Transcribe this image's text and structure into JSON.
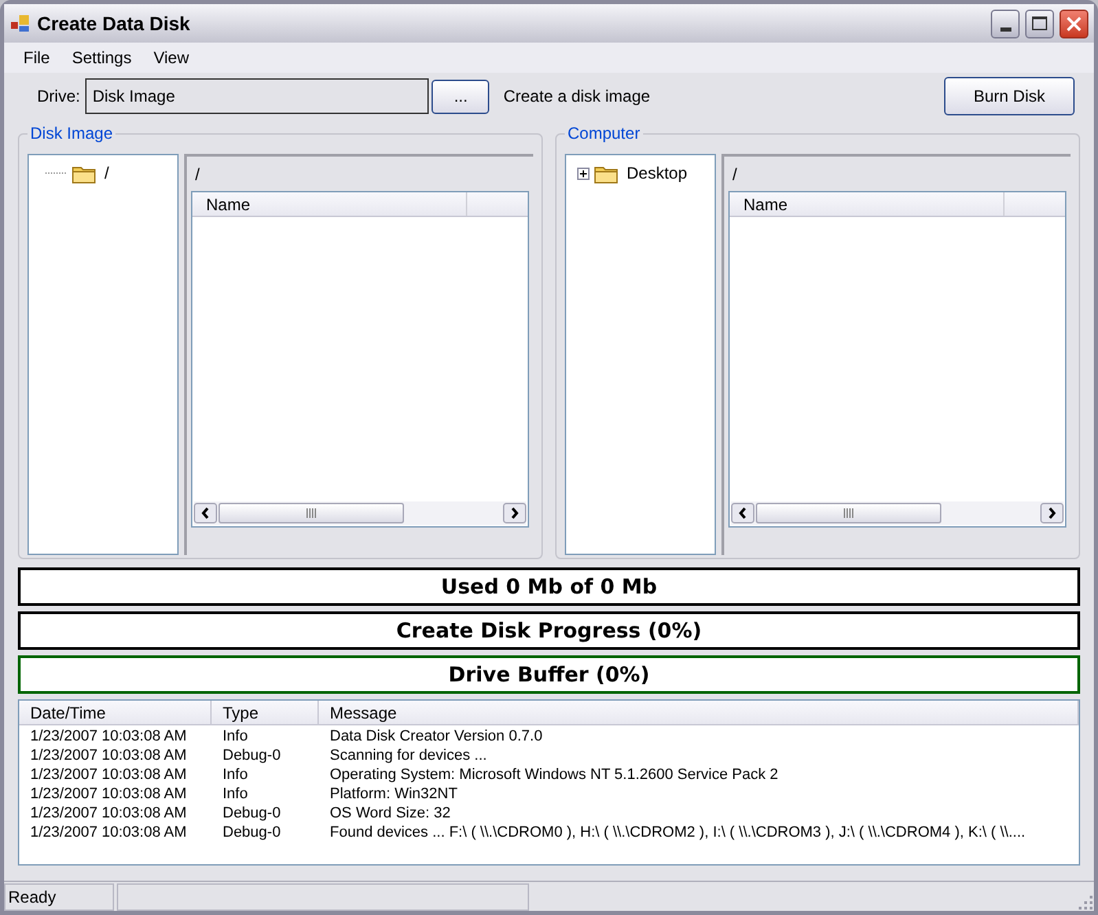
{
  "window": {
    "title": "Create Data Disk"
  },
  "menu": [
    "File",
    "Settings",
    "View"
  ],
  "drive": {
    "label": "Drive:",
    "value": "Disk Image",
    "browse_button": "...",
    "hint": "Create a disk image",
    "burn_button": "Burn Disk"
  },
  "panels": [
    {
      "title": "Disk Image",
      "tree": [
        {
          "label": "/",
          "has_children": false
        }
      ],
      "path": "/",
      "columns": [
        "Name"
      ]
    },
    {
      "title": "Computer",
      "tree": [
        {
          "label": "Desktop",
          "has_children": true
        }
      ],
      "path": "/",
      "columns": [
        "Name"
      ]
    }
  ],
  "bars": [
    {
      "label": "Used 0 Mb of 0 Mb",
      "color": "#000000"
    },
    {
      "label": "Create Disk Progress (0%)",
      "color": "#000000"
    },
    {
      "label": "Drive Buffer (0%)",
      "color": "#006400"
    }
  ],
  "log": {
    "columns": [
      "Date/Time",
      "Type",
      "Message"
    ],
    "rows": [
      {
        "date_time": "1/23/2007 10:03:08 AM",
        "type": "Info",
        "message": "Data Disk Creator Version 0.7.0"
      },
      {
        "date_time": "1/23/2007 10:03:08 AM",
        "type": "Debug-0",
        "message": "Scanning for devices ..."
      },
      {
        "date_time": "1/23/2007 10:03:08 AM",
        "type": "Info",
        "message": "Operating System: Microsoft Windows NT 5.1.2600 Service Pack 2"
      },
      {
        "date_time": "1/23/2007 10:03:08 AM",
        "type": "Info",
        "message": "Platform: Win32NT"
      },
      {
        "date_time": "1/23/2007 10:03:08 AM",
        "type": "Debug-0",
        "message": "OS Word Size: 32"
      },
      {
        "date_time": "1/23/2007 10:03:08 AM",
        "type": "Debug-0",
        "message": "Found devices ... F:\\ ( \\\\.\\CDROM0 ), H:\\ ( \\\\.\\CDROM2 ), I:\\ ( \\\\.\\CDROM3 ), J:\\ ( \\\\.\\CDROM4 ), K:\\ ( \\\\...."
      }
    ]
  },
  "status_bar": {
    "text": "Ready"
  }
}
